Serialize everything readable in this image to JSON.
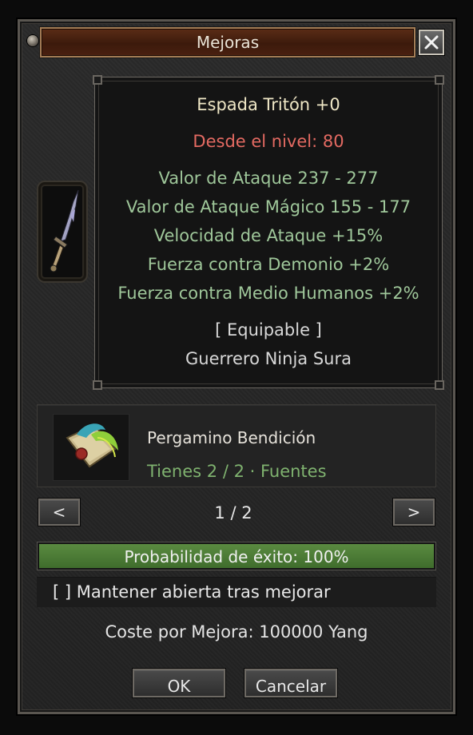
{
  "window": {
    "title": "Mejoras"
  },
  "item": {
    "name": "Espada Tritón +0",
    "level_req": "Desde el nivel: 80",
    "stats": [
      "Valor de Ataque 237 - 277",
      "Valor de Ataque Mágico 155 - 177",
      "Velocidad de Ataque +15%",
      "Fuerza contra Demonio +2%",
      "Fuerza contra Medio Humanos +2%"
    ],
    "equip_label": "[ Equipable ]",
    "classes": "Guerrero Ninja Sura",
    "icon": "sword-icon"
  },
  "material": {
    "name": "Pergamino Bendición",
    "count": "Tienes 2 / 2 · Fuentes",
    "icon": "blessing-scroll-icon"
  },
  "pager": {
    "prev_label": "<",
    "next_label": ">",
    "page": "1 / 2"
  },
  "success": {
    "label": "Probabilidad de éxito: 100%",
    "value": 1.0
  },
  "keep_open": {
    "label": "[ ] Mantener abierta tras mejorar"
  },
  "cost": "Coste por Mejora: 100000 Yang",
  "buttons": {
    "ok": "OK",
    "cancel": "Cancelar"
  },
  "colors": {
    "level_text": "#e46a62",
    "stat_text": "#9fc79a",
    "material_count": "#7fb26f",
    "progress": "#4f7d38",
    "title_bar": "#4a2010"
  }
}
